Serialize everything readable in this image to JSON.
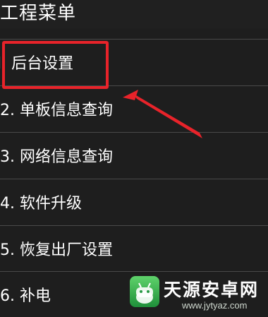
{
  "header": {
    "title": "工程菜单"
  },
  "menu": {
    "items": [
      {
        "label": "l. 后台设置"
      },
      {
        "label": "2. 单板信息查询"
      },
      {
        "label": "3. 网络信息查询"
      },
      {
        "label": "4. 软件升级"
      },
      {
        "label": "5. 恢复出厂设置"
      },
      {
        "label": "6. 补电"
      }
    ]
  },
  "annotation": {
    "highlight_color": "#e8232a"
  },
  "watermark": {
    "name": "天源安卓网",
    "url": "www.jytyaz.com"
  }
}
